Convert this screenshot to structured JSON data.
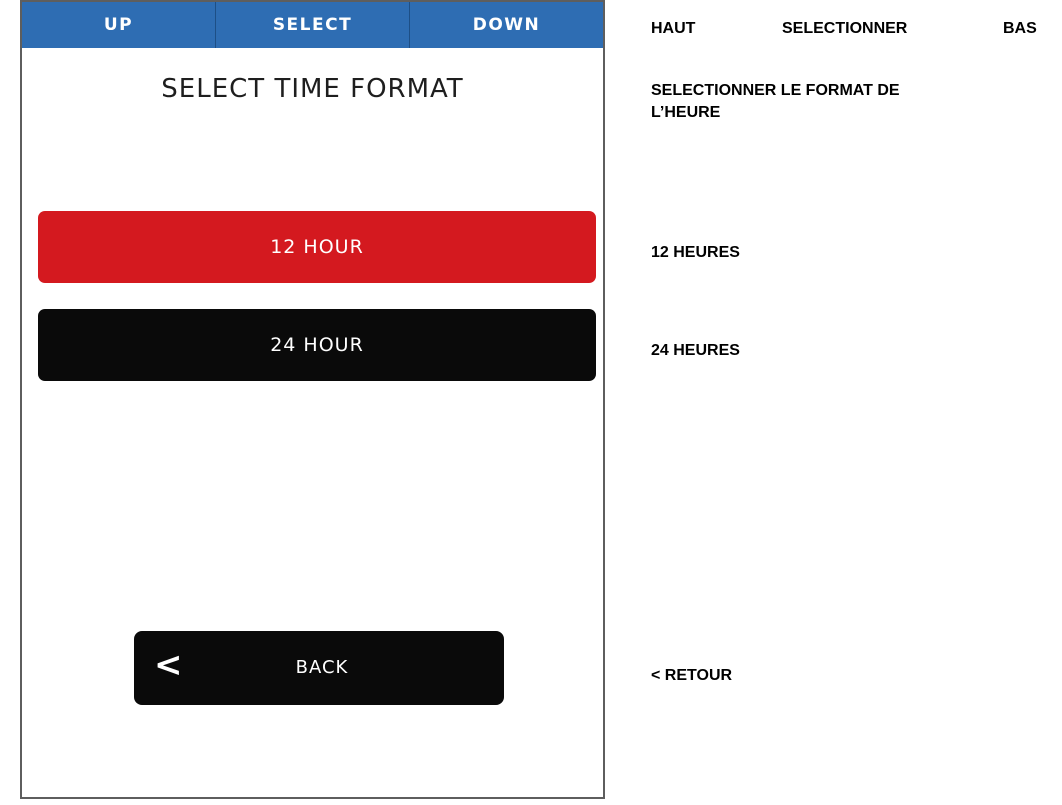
{
  "device": {
    "topbar": {
      "up": "UP",
      "select": "SELECT",
      "down": "DOWN"
    },
    "title": "SELECT TIME FORMAT",
    "options": [
      "12 HOUR",
      "24 HOUR"
    ],
    "selected_option": "12 HOUR",
    "back": {
      "chevron": "<",
      "label": "BACK"
    }
  },
  "translations": {
    "up": "HAUT",
    "select": "SELECTIONNER",
    "down": "BAS",
    "title_line1": "SELECTIONNER LE FORMAT DE",
    "title_line2": "L’HEURE",
    "option_12": "12 HEURES",
    "option_24": "24 HEURES",
    "back": "< RETOUR"
  },
  "colors": {
    "topbar": "#2e6db3",
    "selected": "#d4191f",
    "unselected": "#0a0a0a"
  }
}
